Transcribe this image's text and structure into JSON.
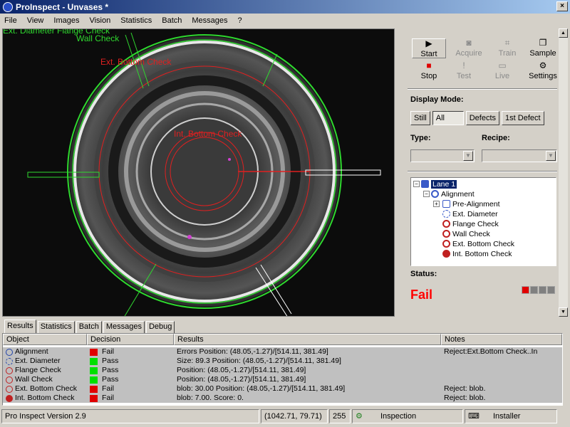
{
  "window": {
    "title": "ProInspect - Unvases *",
    "close_glyph": "×"
  },
  "menu": [
    "File",
    "View",
    "Images",
    "Vision",
    "Statistics",
    "Batch",
    "Messages",
    "?"
  ],
  "overlay_labels": {
    "ext_diameter_flange": "Ext. Diameter Flange Check",
    "wall_check": "Wall Check",
    "ext_bottom": "Ext. Bottom Check",
    "int_bottom": "Int. Bottom Check"
  },
  "toolbar": {
    "start": "Start",
    "stop": "Stop",
    "acquire": "Acquire",
    "test": "Test",
    "train": "Train",
    "live": "Live",
    "sample": "Sample",
    "settings": "Settings"
  },
  "display_mode": {
    "label": "Display Mode:",
    "buttons": [
      "Still",
      "All",
      "Defects",
      "1st Defect"
    ],
    "selected": "All"
  },
  "type_label": "Type:",
  "recipe_label": "Recipe:",
  "tree": {
    "root": "Lane 1",
    "alignment": "Alignment",
    "pre_alignment": "Pre-Alignment",
    "ext_diameter": "Ext. Diameter",
    "flange_check": "Flange Check",
    "wall_check": "Wall Check",
    "ext_bottom": "Ext. Bottom Check",
    "int_bottom": "Int. Bottom Check"
  },
  "status": {
    "label": "Status:",
    "value": "Fail"
  },
  "colors": {
    "fail": "#ff0000",
    "pass": "#00e000",
    "overlay_green": "#2fd82f",
    "overlay_red": "#e02020"
  },
  "tabs": [
    "Results",
    "Statistics",
    "Batch",
    "Messages",
    "Debug"
  ],
  "results": {
    "headers": [
      "Object",
      "Decision",
      "Results",
      "Notes"
    ],
    "rows": [
      {
        "object": "Alignment",
        "decision": "Fail",
        "result": "Errors Position: (48.05,-1.27)/[514.11, 381.49]",
        "notes": "Reject:Ext.Bottom Check..In",
        "color": "#e00000"
      },
      {
        "object": "Ext. Diameter",
        "decision": "Pass",
        "result": "Size: 89.3 Position: (48.05,-1.27)/[514.11, 381.49]",
        "notes": "",
        "color": "#00e000"
      },
      {
        "object": "Flange Check",
        "decision": "Pass",
        "result": "Position: (48.05,-1.27)/[514.11, 381.49]",
        "notes": "",
        "color": "#00e000"
      },
      {
        "object": "Wall Check",
        "decision": "Pass",
        "result": "Position: (48.05,-1.27)/[514.11, 381.49]",
        "notes": "",
        "color": "#00e000"
      },
      {
        "object": "Ext. Bottom Check",
        "decision": "Fail",
        "result": "blob: 30.00 Position: (48.05,-1.27)/[514.11, 381.49]",
        "notes": "Reject: blob.",
        "color": "#e00000"
      },
      {
        "object": "Int. Bottom Check",
        "decision": "Fail",
        "result": "blob: 7.00. Score: 0.",
        "notes": "Reject: blob.",
        "color": "#e00000"
      }
    ]
  },
  "statusbar": {
    "version": "Pro Inspect Version 2.9",
    "coords": "(1042.71, 79.71)",
    "pixel": "255",
    "mode": "Inspection",
    "user": "Installer"
  }
}
